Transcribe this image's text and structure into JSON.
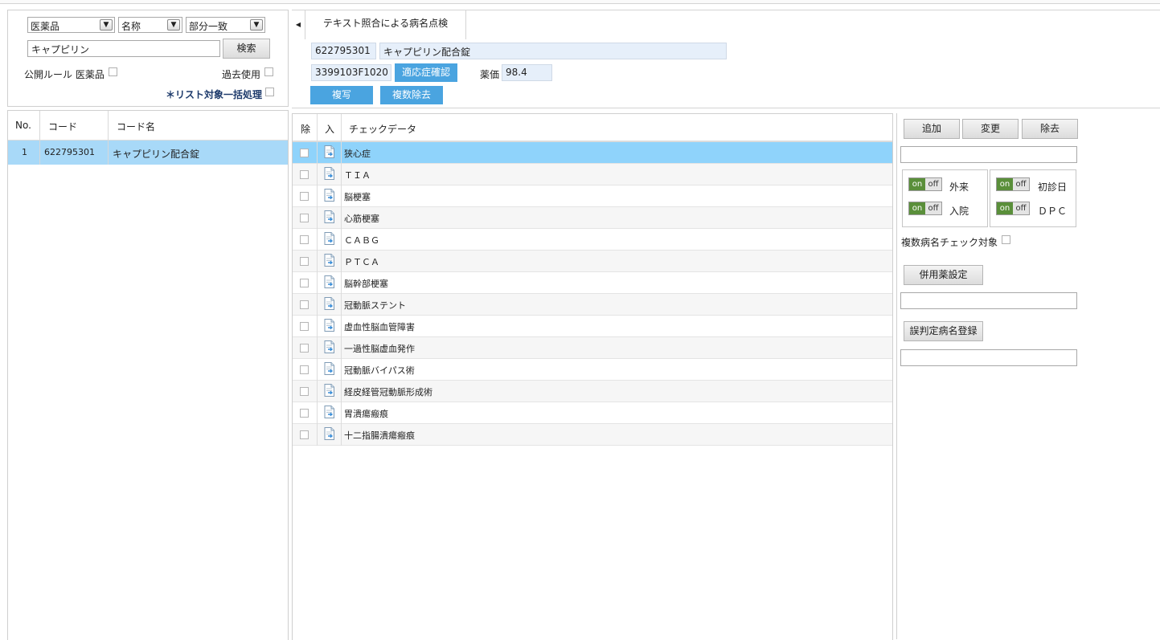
{
  "search": {
    "category": "医薬品",
    "field": "名称",
    "match": "部分一致",
    "query": "キャプピリン",
    "search_button": "検索",
    "public_rule_label": "公開ルール 医薬品",
    "past_use_label": "過去使用",
    "bulk_label": "＊リスト対象一括処理"
  },
  "code_list": {
    "headers": {
      "no": "No.",
      "code": "コード",
      "name": "コード名"
    },
    "rows": [
      {
        "no": "1",
        "code": "622795301",
        "name": "キャプピリン配合錠"
      }
    ]
  },
  "detail": {
    "tab_title": "テキスト照合による病名点検",
    "code": "622795301",
    "name": "キャプピリン配合錠",
    "yj_code": "3399103F1020",
    "indication_button": "適応症確認",
    "price_label": "薬価",
    "price": "98.4",
    "copy_button": "複写",
    "multi_remove_button": "複数除去"
  },
  "check_list": {
    "headers": {
      "remove": "除",
      "input": "入",
      "data": "チェックデータ"
    },
    "rows": [
      "狭心症",
      "ＴＩＡ",
      "脳梗塞",
      "心筋梗塞",
      "ＣＡＢＧ",
      "ＰＴＣＡ",
      "脳幹部梗塞",
      "冠動脈ステント",
      "虚血性脳血管障害",
      "一過性脳虚血発作",
      "冠動脈バイパス術",
      "経皮経管冠動脈形成術",
      "胃潰瘍瘢痕",
      "十二指腸潰瘍瘢痕"
    ]
  },
  "right_panel": {
    "add_button": "追加",
    "change_button": "変更",
    "remove_button": "除去",
    "toggle_on": "on",
    "toggle_off": "off",
    "outpatient": "外来",
    "inpatient": "入院",
    "first_visit": "初診日",
    "dpc": "ＤＰＣ",
    "multi_check_label": "複数病名チェック対象",
    "concomitant_button": "併用薬設定",
    "misjudge_button": "誤判定病名登録"
  }
}
